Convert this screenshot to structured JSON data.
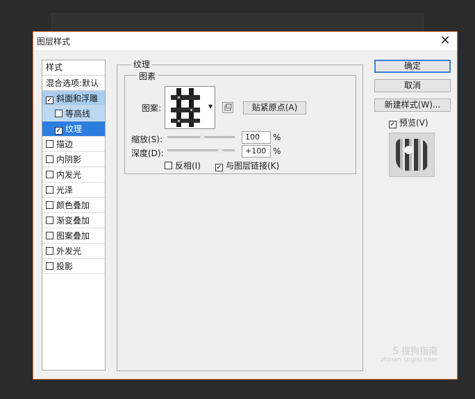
{
  "window": {
    "title": "图层样式"
  },
  "left_panel": {
    "header": "样式",
    "blend_options": "混合选项:默认",
    "items": [
      {
        "label": "斜面和浮雕",
        "checked": true,
        "sub": false
      },
      {
        "label": "等高线",
        "checked": false,
        "sub": true
      },
      {
        "label": "纹理",
        "checked": true,
        "sub": true
      },
      {
        "label": "描边",
        "checked": false,
        "sub": false
      },
      {
        "label": "内阴影",
        "checked": false,
        "sub": false
      },
      {
        "label": "内发光",
        "checked": false,
        "sub": false
      },
      {
        "label": "光泽",
        "checked": false,
        "sub": false
      },
      {
        "label": "颜色叠加",
        "checked": false,
        "sub": false
      },
      {
        "label": "渐变叠加",
        "checked": false,
        "sub": false
      },
      {
        "label": "图案叠加",
        "checked": false,
        "sub": false
      },
      {
        "label": "外发光",
        "checked": false,
        "sub": false
      },
      {
        "label": "投影",
        "checked": false,
        "sub": false
      }
    ]
  },
  "texture": {
    "section_title": "纹理",
    "group_title": "图素",
    "pattern_label": "图案:",
    "snap_button": "贴紧原点(A)",
    "scale_label": "缩放(S):",
    "scale_value": "100",
    "scale_unit": "%",
    "depth_label": "深度(D):",
    "depth_value": "+100",
    "depth_unit": "%",
    "invert_label": "反相(I)",
    "invert_checked": false,
    "link_label": "与图层链接(K)",
    "link_checked": true
  },
  "buttons": {
    "ok": "确定",
    "cancel": "取消",
    "new_style": "新建样式(W)...",
    "preview_label": "预览(V)",
    "preview_checked": true
  },
  "watermark": {
    "line1": "S 搜狗指南",
    "line2": "zhinan.sogou.com"
  }
}
